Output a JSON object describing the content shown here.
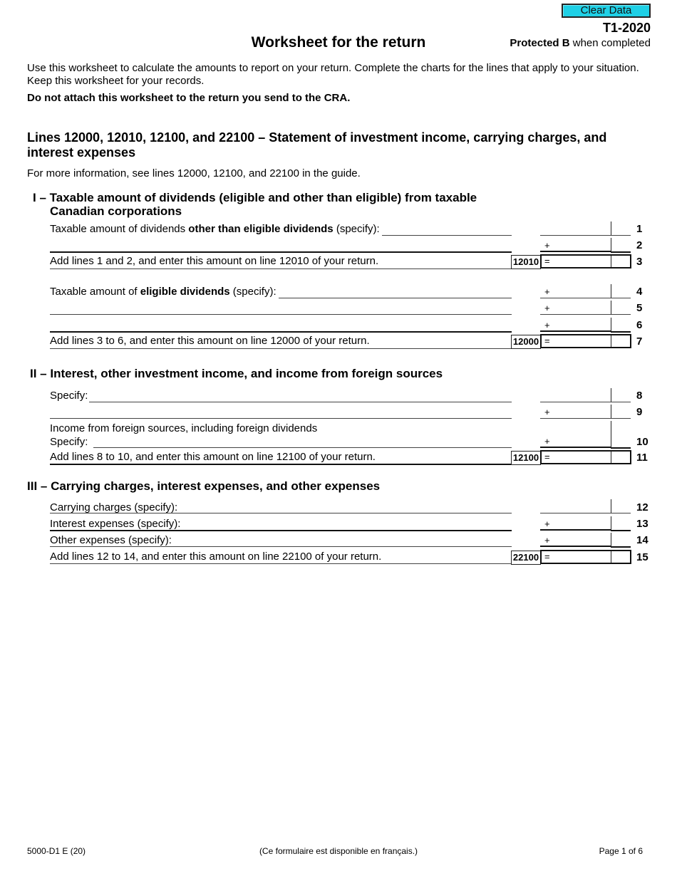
{
  "header": {
    "clear_button": "Clear Data",
    "form_id": "T1-2020",
    "protected_bold": "Protected B",
    "protected_rest": " when completed",
    "title": "Worksheet for the return"
  },
  "intro": {
    "text": "Use this worksheet to calculate the amounts to report on your return. Complete the charts for the lines that apply to your situation. Keep this worksheet for your records.",
    "warning": "Do not attach this worksheet to the return you send to the CRA."
  },
  "section": {
    "title": "Lines 12000, 12010, 12100, and 22100 – Statement of investment income, carrying charges, and interest expenses",
    "more_info": "For more information, see lines 12000, 12100, and 22100 in the guide."
  },
  "part1": {
    "num": "I –",
    "title_line1": "Taxable amount of dividends (eligible and other than eligible) from taxable",
    "title_line2": "Canadian corporations",
    "line1_pre": "Taxable amount of dividends ",
    "line1_bold": "other than eligible dividends",
    "line1_post": " (specify):",
    "line3_text": "Add lines 1 and 2, and enter this amount on line 12010 of your return.",
    "line3_code": "12010",
    "line4_pre": "Taxable amount of ",
    "line4_bold": "eligible dividends",
    "line4_post": " (specify):",
    "line7_text": "Add lines 3 to 6, and enter this amount on line 12000 of your return.",
    "line7_code": "12000"
  },
  "part2": {
    "num": "II –",
    "title": "Interest, other investment income, and income from foreign sources",
    "line8_text": "Specify:",
    "line10_text1": "Income from foreign sources, including foreign dividends",
    "line10_text2": "Specify:",
    "line11_text": "Add lines 8 to 10, and enter this amount on line 12100 of your return.",
    "line11_code": "12100"
  },
  "part3": {
    "num": "III –",
    "title": "Carrying charges, interest expenses, and other expenses",
    "line12_text": "Carrying charges (specify):",
    "line13_text": "Interest expenses (specify):",
    "line14_text": "Other expenses (specify):",
    "line15_text": "Add lines 12 to 14, and enter this amount on line 22100 of your return.",
    "line15_code": "22100"
  },
  "signs": {
    "plus": "+",
    "equals": "="
  },
  "line_numbers": [
    "1",
    "2",
    "3",
    "4",
    "5",
    "6",
    "7",
    "8",
    "9",
    "10",
    "11",
    "12",
    "13",
    "14",
    "15"
  ],
  "footer": {
    "form_code": "5000-D1 E (20)",
    "french_note": "(Ce formulaire est disponible en français.)",
    "page": "Page 1 of 6"
  },
  "colors": {
    "clear_button_bg": "#1fd0e6"
  }
}
